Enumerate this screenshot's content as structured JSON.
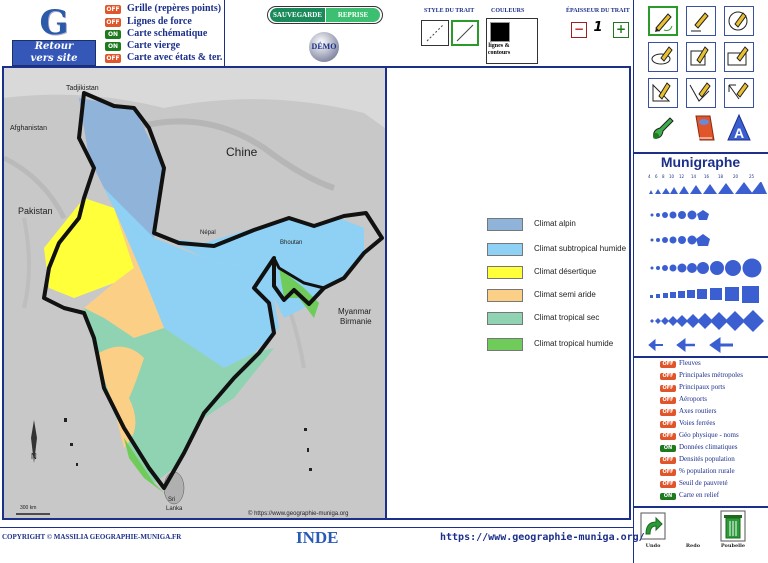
{
  "logo": {
    "letter": "G",
    "link_line1": "Retour",
    "link_line2": "vers site"
  },
  "layers_top": [
    {
      "state": "OFF",
      "label": "Grille (repères points)"
    },
    {
      "state": "OFF",
      "label": "Lignes de force"
    },
    {
      "state": "ON",
      "label": "Carte schématique"
    },
    {
      "state": "ON",
      "label": "Carte vierge"
    },
    {
      "state": "OFF",
      "label": "Carte avec états & ter."
    }
  ],
  "save": {
    "save_label": "SAUVEGARDE",
    "reprise_label": "REPRISE",
    "demo_label": "DÉMO"
  },
  "style_trait": {
    "title": "STYLE DU TRAIT"
  },
  "couleurs": {
    "title": "COULEURS",
    "caption_line1": "lignes &",
    "caption_line2": "contours",
    "selected_color": "#000000"
  },
  "epaisseur": {
    "title": "ÉPAISSEUR DU TRAIT",
    "minus": "−",
    "value": "1",
    "plus": "+"
  },
  "map": {
    "labels": {
      "tadjikistan": "Tadjikistan",
      "afghanistan": "Afghanistan",
      "chine": "Chine",
      "pakistan": "Pakistan",
      "nepal": "Népal",
      "bhoutan": "Bhoutan",
      "myanmar1": "Myanmar",
      "myanmar2": "Birmanie",
      "srilanka1": "Sri",
      "srilanka2": "Lanka",
      "north": "N",
      "scale": "300 km",
      "credit": "© https://www.geographie-muniga.org"
    }
  },
  "legend": [
    {
      "label": "Climat alpin",
      "color": "#8fb3d9"
    },
    {
      "label": "Climat subtropical humide",
      "color": "#8ed1f5"
    },
    {
      "label": "Climat désertique",
      "color": "#ffff3a"
    },
    {
      "label": "Climat semi aride",
      "color": "#fbcf86"
    },
    {
      "label": "Climat tropical sec",
      "color": "#8fd3b3"
    },
    {
      "label": "Climat tropical humide",
      "color": "#6fcb5a"
    }
  ],
  "munigraphe": {
    "title": "Munigraphe",
    "sizes": [
      "4",
      "6",
      "8",
      "10",
      "12",
      "14",
      "16",
      "18",
      "20",
      "25"
    ]
  },
  "layers_right": [
    {
      "state": "OFF",
      "label": "Fleuves"
    },
    {
      "state": "OFF",
      "label": "Principales métropoles"
    },
    {
      "state": "OFF",
      "label": "Principaux ports"
    },
    {
      "state": "OFF",
      "label": "Aéroports"
    },
    {
      "state": "OFF",
      "label": "Axes routiers"
    },
    {
      "state": "OFF",
      "label": "Voies ferrées"
    },
    {
      "state": "OFF",
      "label": "Géo physique - noms"
    },
    {
      "state": "ON",
      "label": "Données climatiques"
    },
    {
      "state": "OFF",
      "label": "Densités population"
    },
    {
      "state": "OFF",
      "label": "% population rurale"
    },
    {
      "state": "OFF",
      "label": "Seuil de pauvreté"
    },
    {
      "state": "ON",
      "label": "Carte en relief"
    }
  ],
  "footer": {
    "copyright": "COPYRIGHT © MASSILIA GEOGRAPHIE-MUNIGA.FR",
    "title": "INDE",
    "url": "https://www.geographie-muniga.org/",
    "undo": "Undo",
    "redo": "Redo",
    "trash": "Poubelle"
  }
}
